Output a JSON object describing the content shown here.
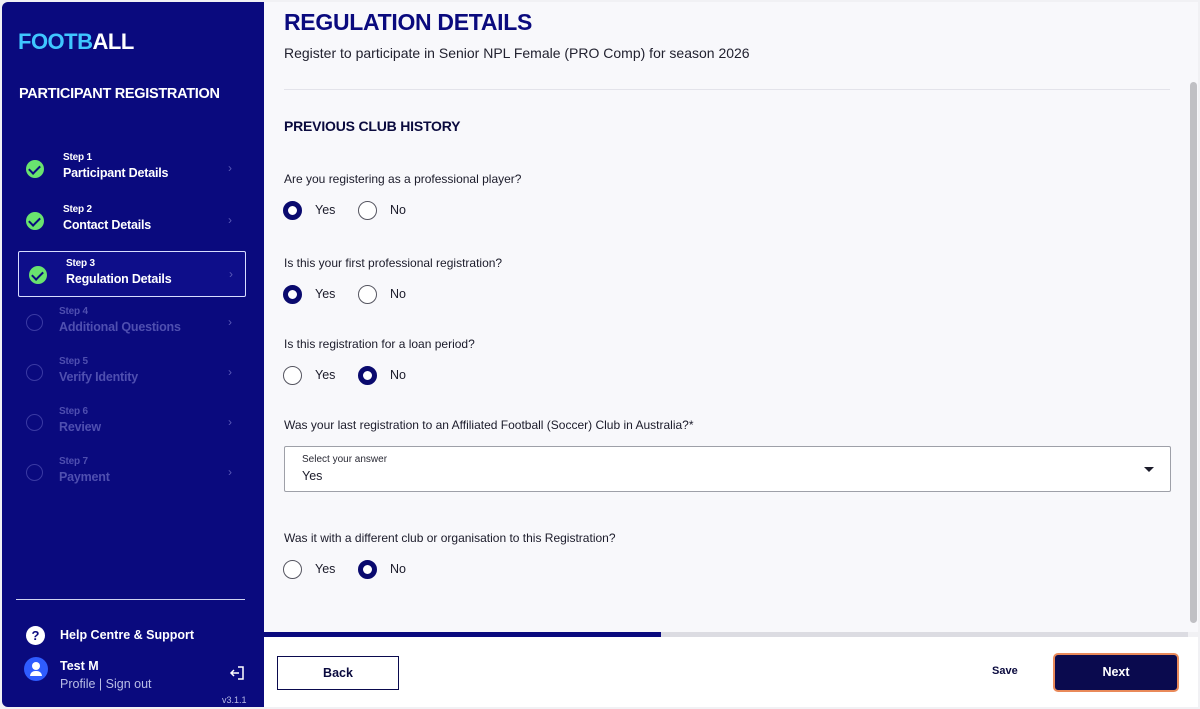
{
  "sidebar": {
    "logo_part1": "FOOTB",
    "logo_part2": "ALL",
    "title": "PARTICIPANT REGISTRATION",
    "steps": [
      {
        "num": "Step 1",
        "name": "Participant Details",
        "status": "done"
      },
      {
        "num": "Step 2",
        "name": "Contact Details",
        "status": "done"
      },
      {
        "num": "Step 3",
        "name": "Regulation Details",
        "status": "active"
      },
      {
        "num": "Step 4",
        "name": "Additional Questions",
        "status": "todo"
      },
      {
        "num": "Step 5",
        "name": "Verify Identity",
        "status": "todo"
      },
      {
        "num": "Step 6",
        "name": "Review",
        "status": "todo"
      },
      {
        "num": "Step 7",
        "name": "Payment",
        "status": "todo"
      }
    ],
    "help_label": "Help Centre & Support",
    "help_icon": "?",
    "user_name": "Test M",
    "user_links": "Profile | Sign out",
    "version": "v3.1.1"
  },
  "main": {
    "title": "REGULATION DETAILS",
    "subtitle": "Register to participate in Senior NPL Female (PRO Comp) for season 2026",
    "section_title": "PREVIOUS CLUB HISTORY",
    "questions": [
      {
        "text": "Are you registering as a professional player?",
        "selected": "Yes"
      },
      {
        "text": "Is this your first professional registration?",
        "selected": "Yes"
      },
      {
        "text": "Is this registration for a loan period?",
        "selected": "No"
      },
      {
        "text": "Was it with a different club or organisation to this Registration?",
        "selected": "No"
      }
    ],
    "option_yes": "Yes",
    "option_no": "No",
    "select_question": "Was your last registration to an Affiliated Football (Soccer) Club in Australia?*",
    "select_label": "Select your answer",
    "select_value": "Yes"
  },
  "footer": {
    "progress_fraction": 0.43,
    "back_label": "Back",
    "save_label": "Save",
    "next_label": "Next"
  },
  "colors": {
    "brand_navy": "#0a0a7e",
    "logo_accent": "#3fc6ff",
    "check_green": "#69e36f",
    "next_outline": "#e98a5a"
  }
}
